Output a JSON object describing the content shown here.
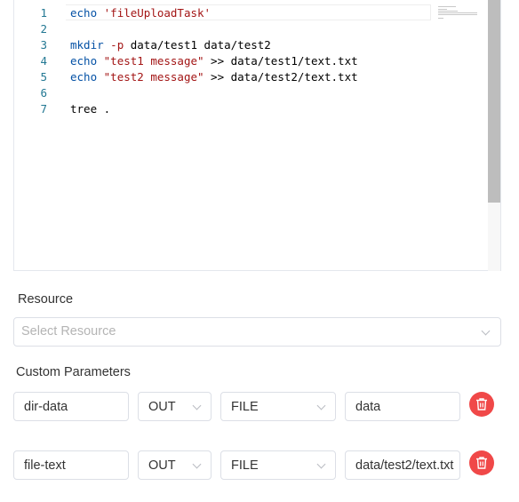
{
  "editor": {
    "lines": [
      {
        "num": "1",
        "tokens": [
          {
            "t": "echo",
            "c": "kw2"
          },
          {
            "t": " "
          },
          {
            "t": "'fileUploadTask'",
            "c": "str"
          }
        ]
      },
      {
        "num": "2",
        "tokens": []
      },
      {
        "num": "3",
        "tokens": [
          {
            "t": "mkdir",
            "c": "kw2"
          },
          {
            "t": " "
          },
          {
            "t": "-p",
            "c": "opt"
          },
          {
            "t": " data/test1 data/test2"
          }
        ]
      },
      {
        "num": "4",
        "tokens": [
          {
            "t": "echo",
            "c": "kw2"
          },
          {
            "t": " "
          },
          {
            "t": "\"test1 message\"",
            "c": "str"
          },
          {
            "t": " >> data/test1/text.txt"
          }
        ]
      },
      {
        "num": "5",
        "tokens": [
          {
            "t": "echo",
            "c": "kw2"
          },
          {
            "t": " "
          },
          {
            "t": "\"test2 message\"",
            "c": "str"
          },
          {
            "t": " >> data/test2/text.txt"
          }
        ]
      },
      {
        "num": "6",
        "tokens": []
      },
      {
        "num": "7",
        "tokens": [
          {
            "t": "tree ."
          }
        ]
      }
    ]
  },
  "resource": {
    "label": "Resource",
    "placeholder": "Select Resource"
  },
  "custom_params": {
    "label": "Custom Parameters",
    "rows": [
      {
        "name": "dir-data",
        "direct": "OUT",
        "type": "FILE",
        "value": "data"
      },
      {
        "name": "file-text",
        "direct": "OUT",
        "type": "FILE",
        "value": "data/test2/text.txt"
      }
    ]
  },
  "colors": {
    "delete_button": "#f04848",
    "line_number": "#237893",
    "keyword": "#0451a5",
    "string": "#a31515"
  },
  "icons": {
    "delete": "trash-icon",
    "dropdown": "chevron-down-icon"
  }
}
